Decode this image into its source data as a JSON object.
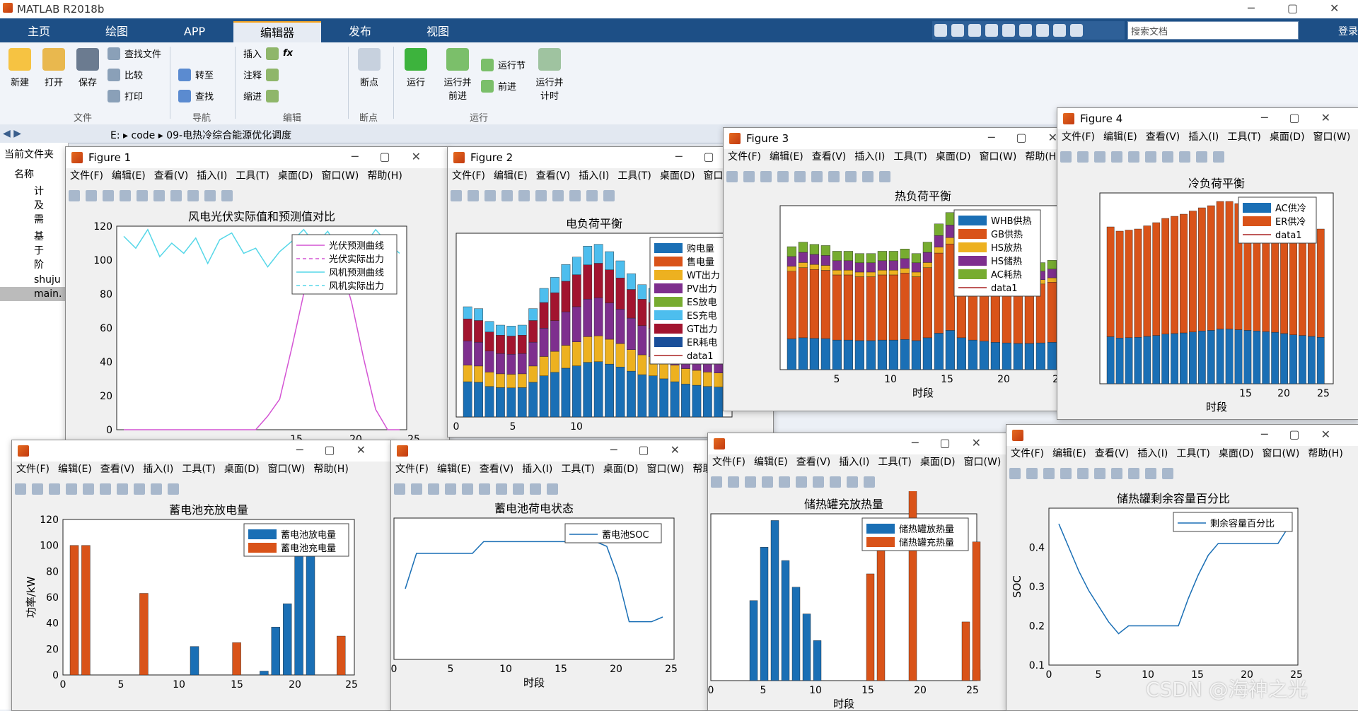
{
  "app": {
    "title": "MATLAB R2018b",
    "login": "登录",
    "search_placeholder": "搜索文档"
  },
  "tabs": [
    "主页",
    "绘图",
    "APP",
    "编辑器",
    "发布",
    "视图"
  ],
  "ribbon": {
    "file": {
      "new": "新建",
      "open": "打开",
      "save": "保存",
      "find": "查找文件",
      "compare": "比较",
      "print": "打印",
      "group": "文件"
    },
    "nav": {
      "goto": "转至",
      "find": "查找",
      "group": "导航"
    },
    "edit": {
      "insert": "插入",
      "comment": "注释",
      "indent": "缩进",
      "fx": "fx",
      "group": "编辑"
    },
    "breakpoint": {
      "label": "断点",
      "group": "断点"
    },
    "run": {
      "run": "运行",
      "run_advance": "运行并\n前进",
      "run_section": "运行节",
      "advance": "前进",
      "run_time": "运行并\n计时",
      "group": "运行"
    }
  },
  "address": {
    "drive": "E:",
    "folder1": "code",
    "folder2": "09-电热冷综合能源优化调度"
  },
  "filepanel": {
    "title": "当前文件夹",
    "col": "名称",
    "items": [
      "计及需",
      "基于阶",
      "shuju",
      "main."
    ]
  },
  "figmenu": [
    "文件(F)",
    "编辑(E)",
    "查看(V)",
    "插入(I)",
    "工具(T)",
    "桌面(D)",
    "窗口(W)",
    "帮助(H)"
  ],
  "figures": [
    {
      "name": "Figure 1"
    },
    {
      "name": "Figure 2"
    },
    {
      "name": "Figure 3"
    },
    {
      "name": "Figure 4"
    }
  ],
  "watermark": "CSDN @海神之光",
  "chart_data": [
    {
      "type": "line",
      "title": "风电光伏实际值和预测值对比",
      "ylim": [
        0,
        120
      ],
      "xlim": [
        1,
        24
      ],
      "legend": [
        "光伏预测曲线",
        "光伏实际出力",
        "风机预测曲线",
        "风机实际出力"
      ],
      "series": [
        {
          "name": "风机预测曲线",
          "values": [
            114,
            107,
            118,
            102,
            110,
            104,
            113,
            98,
            112,
            116,
            104,
            107,
            96,
            105,
            111,
            118,
            109,
            117,
            106,
            114,
            108,
            118,
            110,
            104
          ]
        },
        {
          "name": "光伏预测曲线",
          "values": [
            0,
            0,
            0,
            0,
            0,
            0,
            0,
            0,
            0,
            0,
            0,
            0,
            8,
            18,
            48,
            80,
            98,
            104,
            100,
            75,
            42,
            12,
            0,
            0
          ]
        }
      ]
    },
    {
      "type": "bar",
      "title": "电负荷平衡",
      "legend": [
        "购电量",
        "售电量",
        "WT出力",
        "PV出力",
        "ES放电",
        "ES充电",
        "GT出力",
        "ER耗电",
        "data1"
      ],
      "values": [
        600,
        590,
        520,
        500,
        495,
        500,
        590,
        700,
        760,
        830,
        870,
        930,
        940,
        900,
        850,
        780,
        720,
        700,
        650,
        600,
        560,
        540,
        520,
        510
      ]
    },
    {
      "type": "bar",
      "title": "热负荷平衡",
      "xlabel": "时段",
      "legend": [
        "WHB供热",
        "GB供热",
        "HS放热",
        "HS储热",
        "AC耗热",
        "data1"
      ],
      "values": [
        540,
        560,
        550,
        545,
        520,
        520,
        510,
        510,
        520,
        520,
        530,
        510,
        560,
        640,
        690,
        560,
        520,
        500,
        480,
        470,
        460,
        460,
        470,
        480
      ]
    },
    {
      "type": "bar",
      "title": "冷负荷平衡",
      "xlabel": "时段",
      "legend": [
        "AC供冷",
        "ER供冷",
        "data1"
      ],
      "values": [
        740,
        720,
        725,
        730,
        745,
        760,
        780,
        790,
        800,
        815,
        830,
        840,
        860,
        860,
        850,
        840,
        830,
        820,
        810,
        790,
        770,
        760,
        745,
        730
      ]
    },
    {
      "type": "bar",
      "title": "蓄电池充放电量",
      "ylabel": "功率/kW",
      "ylim": [
        0,
        120
      ],
      "legend": [
        "蓄电池放电量",
        "蓄电池充电量"
      ],
      "series": [
        {
          "name": "蓄电池放电量",
          "values": [
            0,
            0,
            0,
            0,
            0,
            0,
            0,
            0,
            0,
            0,
            22,
            0,
            0,
            0,
            0,
            0,
            3,
            37,
            55,
            100,
            100,
            0,
            0,
            0
          ]
        },
        {
          "name": "蓄电池充电量",
          "values": [
            100,
            100,
            0,
            0,
            0,
            0,
            63,
            0,
            0,
            0,
            0,
            0,
            0,
            0,
            25,
            0,
            0,
            0,
            0,
            0,
            0,
            0,
            0,
            30
          ]
        }
      ]
    },
    {
      "type": "line",
      "title": "蓄电池荷电状态",
      "xlabel": "时段",
      "legend": [
        "蓄电池SOC"
      ],
      "values": [
        0.6,
        0.75,
        0.75,
        0.75,
        0.75,
        0.75,
        0.75,
        0.8,
        0.8,
        0.8,
        0.8,
        0.8,
        0.8,
        0.8,
        0.8,
        0.8,
        0.8,
        0.8,
        0.78,
        0.65,
        0.46,
        0.46,
        0.46,
        0.48
      ]
    },
    {
      "type": "bar",
      "title": "储热罐充放热量",
      "xlabel": "时段",
      "legend": [
        "储热罐放热量",
        "储热罐充热量"
      ]
    },
    {
      "type": "line",
      "title": "储热罐剩余容量百分比",
      "ylabel": "SOC",
      "ylim": [
        0.1,
        0.5
      ],
      "legend": [
        "剩余容量百分比"
      ],
      "values": [
        0.46,
        0.4,
        0.34,
        0.29,
        0.25,
        0.21,
        0.18,
        0.2,
        0.2,
        0.2,
        0.2,
        0.2,
        0.2,
        0.27,
        0.33,
        0.38,
        0.41,
        0.41,
        0.41,
        0.41,
        0.41,
        0.41,
        0.41,
        0.45
      ]
    }
  ]
}
